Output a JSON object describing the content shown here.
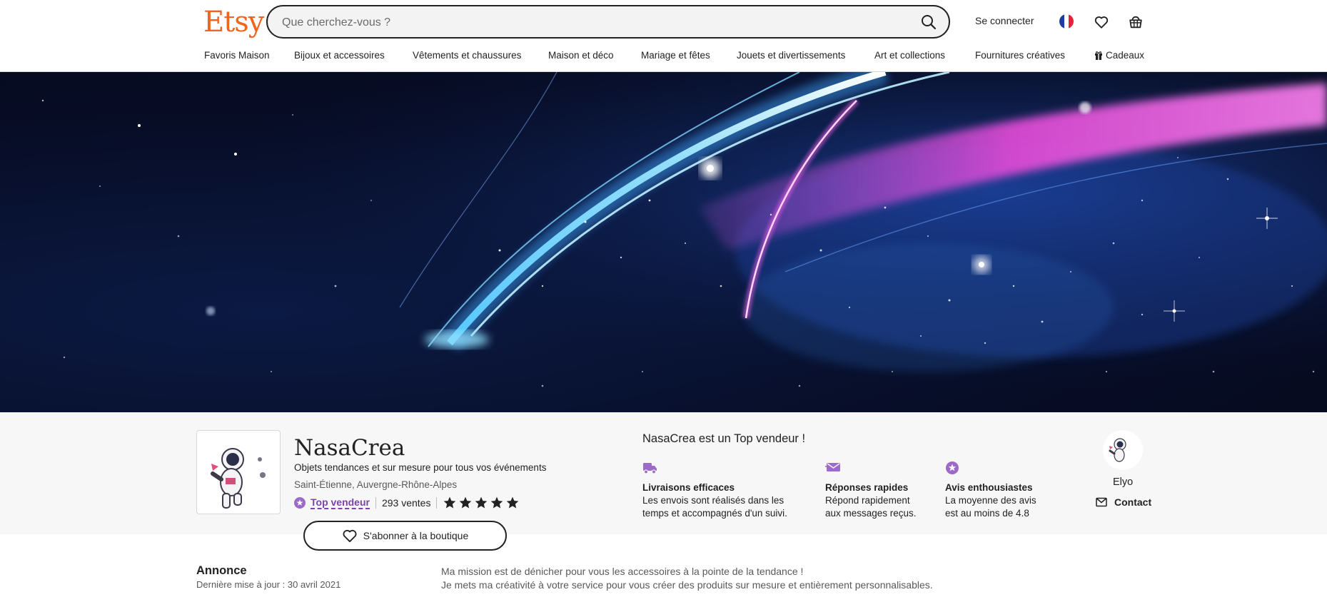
{
  "header": {
    "logo": "Etsy",
    "search": {
      "placeholder": "Que cherchez-vous ?",
      "value": "",
      "icon": "search-icon"
    },
    "signin_label": "Se connecter",
    "locale_icon": "flag-france-icon",
    "icons": [
      "heart-icon",
      "basket-icon"
    ]
  },
  "nav": {
    "items": [
      {
        "label": "Favoris Maison"
      },
      {
        "label": "Bijoux et accessoires"
      },
      {
        "label": "Vêtements et chaussures"
      },
      {
        "label": "Maison et déco"
      },
      {
        "label": "Mariage et fêtes"
      },
      {
        "label": "Jouets et divertissements"
      },
      {
        "label": "Art et collections"
      },
      {
        "label": "Fournitures créatives"
      },
      {
        "label": "Cadeaux",
        "icon": "gift-icon"
      }
    ]
  },
  "banner": {
    "description_icon": "galaxy-comet-banner"
  },
  "shop": {
    "name": "NasaCrea",
    "tagline": "Objets tendances et sur mesure pour tous vos événements",
    "location": "Saint-Étienne, Auvergne-Rhône-Alpes",
    "badge_label": "Top vendeur",
    "sales": "293 ventes",
    "rating": 5,
    "rating_max": 5,
    "follow_label": "S'abonner à la boutique",
    "avatar_icon": "astronaut-on-moon-avatar"
  },
  "top_seller": {
    "title": "NasaCrea est un Top vendeur !",
    "perks": [
      {
        "icon": "delivery-truck-icon",
        "title": "Livraisons efficaces",
        "line1": "Les envois sont réalisés dans les",
        "line2": "temps et accompagnés d'un suivi."
      },
      {
        "icon": "fast-message-icon",
        "title": "Réponses rapides",
        "line1": "Répond rapidement",
        "line2": "aux messages reçus."
      },
      {
        "icon": "star-badge-icon",
        "title": "Avis enthousiastes",
        "line1": "La moyenne des avis",
        "line2": "est au moins de 4.8"
      }
    ]
  },
  "owner": {
    "name": "Elyo",
    "contact_label": "Contact",
    "contact_icon": "envelope-icon"
  },
  "announcement": {
    "title": "Annonce",
    "updated": "Dernière mise à jour : 30 avril 2021",
    "line1": "Ma mission est de dénicher pour vous les accessoires à la pointe de la tendance !",
    "line2": "Je mets ma créativité à votre service pour vous créer des produits sur mesure et entièrement personnalisables."
  },
  "colors": {
    "brand": "#f1641e",
    "accent_purple": "#7b45a8",
    "strip_bg": "#f7f7f7"
  }
}
